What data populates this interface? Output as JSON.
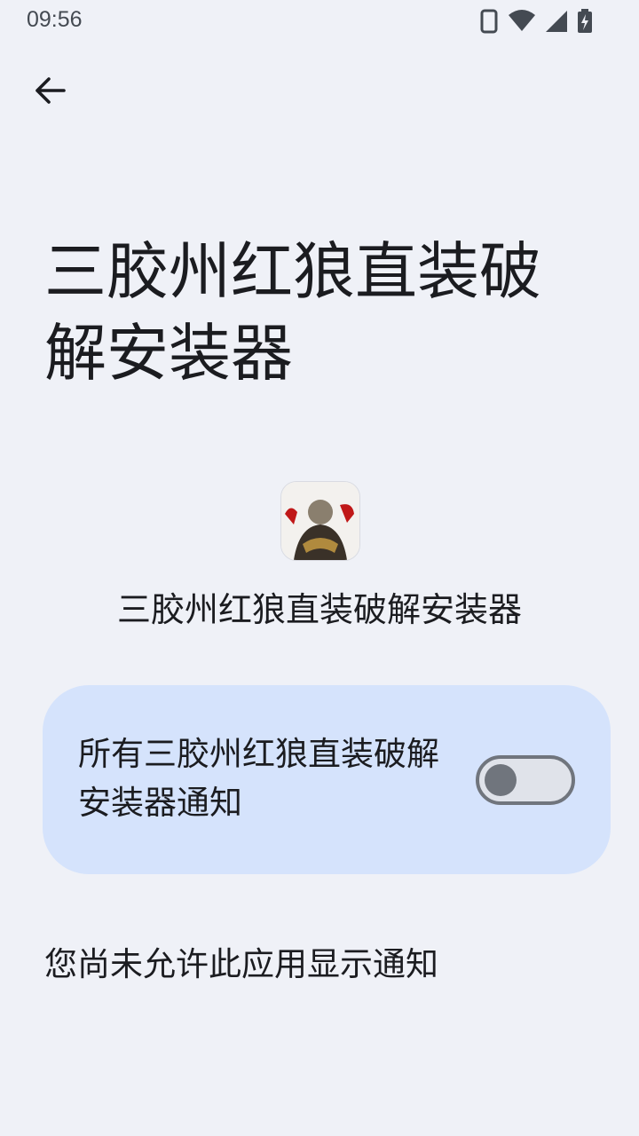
{
  "status_bar": {
    "time": "09:56",
    "icons": [
      "phone-icon",
      "wifi-icon",
      "signal-icon",
      "battery-charging-icon"
    ]
  },
  "header": {
    "back_icon": "arrow-left-icon",
    "title": "三胶州红狼直装破解安装器"
  },
  "app": {
    "icon": "app-icon",
    "name": "三胶州红狼直装破解安装器"
  },
  "notification_setting": {
    "label": "所有三胶州红狼直装破解安装器通知",
    "enabled": false
  },
  "notice": "您尚未允许此应用显示通知",
  "colors": {
    "background": "#eff1f7",
    "card": "#d5e3fc",
    "toggle_track": "#e0e3ea",
    "toggle_outline": "#70757d",
    "text": "#1b1c20"
  }
}
